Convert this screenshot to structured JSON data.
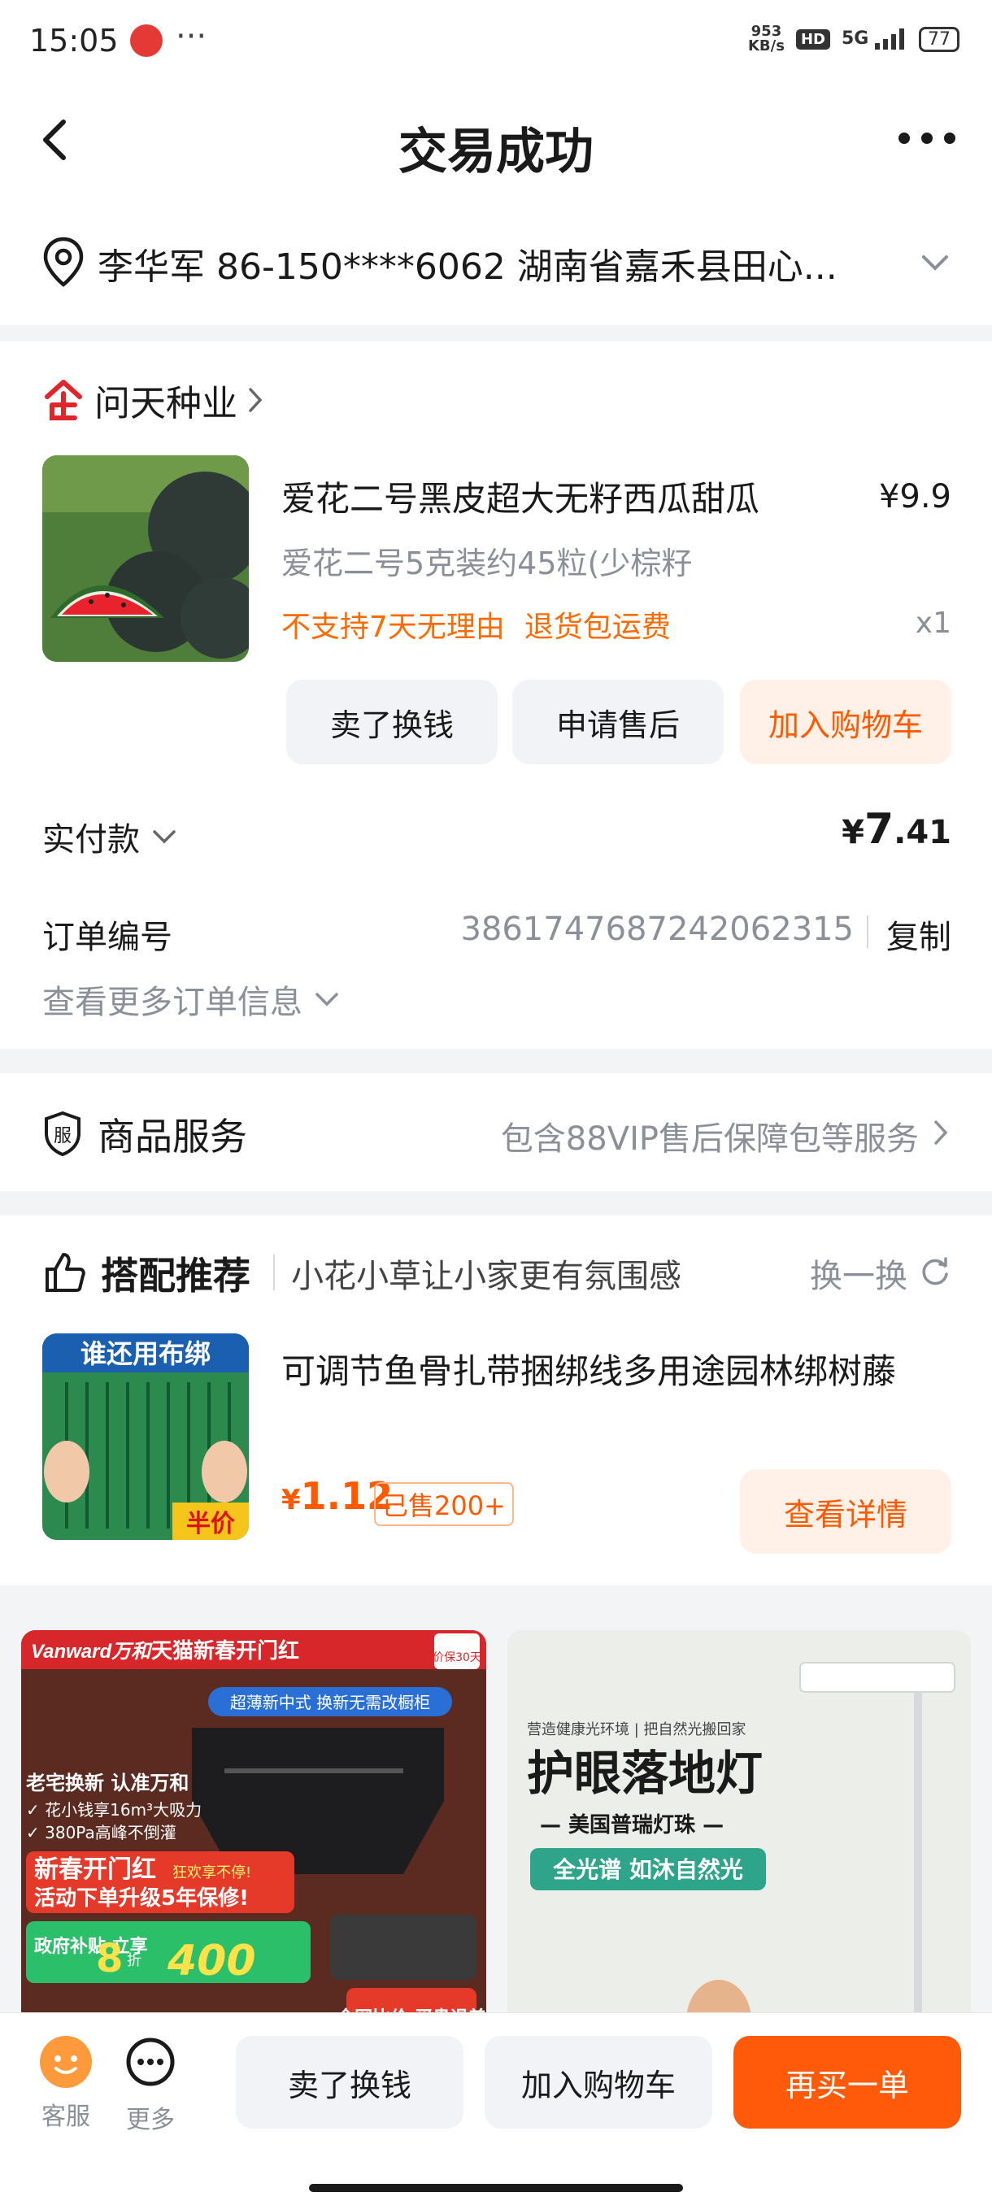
{
  "status_bar": {
    "time": "15:05",
    "dots": "···",
    "speed_top": "953",
    "speed_bottom": "KB/s",
    "hd": "HD",
    "signal": "5G",
    "battery": "77"
  },
  "header": {
    "title": "交易成功"
  },
  "address": {
    "text": "李华军  86-150****6062  湖南省嘉禾县田心..."
  },
  "shop": {
    "name": "问天种业"
  },
  "product": {
    "title": "爱花二号黑皮超大无籽西瓜甜瓜",
    "price": "¥9.9",
    "spec": "爱花二号5克装约45粒(少棕籽",
    "tags": [
      "不支持7天无理由",
      "退货包运费"
    ],
    "qty": "x1",
    "buttons": [
      "卖了换钱",
      "申请售后",
      "加入购物车"
    ]
  },
  "payment": {
    "label": "实付款",
    "currency": "¥",
    "amount_int": "7",
    "amount_dec": ".41"
  },
  "order": {
    "label": "订单编号",
    "number": "3861747687242062315",
    "copy": "复制",
    "more_info": "查看更多订单信息"
  },
  "service": {
    "title": "商品服务",
    "desc": "包含88VIP售后保障包等服务"
  },
  "recommend": {
    "title": "搭配推荐",
    "subtitle": "小花小草让小家更有氛围感",
    "swap": "换一换",
    "item_name": "可调节鱼骨扎带捆绑线多用途园林绑树藤",
    "currency": "¥",
    "price": "1.12",
    "sold": "已售200+",
    "detail_btn": "查看详情",
    "img_text_top": "谁还用布绑",
    "img_text_bottom": "半价"
  },
  "feed": {
    "card1": {
      "brand": "Vanward万和",
      "campaign": "天猫新春开门红",
      "badge": "价保30天",
      "pill": "超薄新中式 换新无需改橱柜",
      "headline": "老宅换新 认准万和",
      "bullets": [
        "✓ 花小钱享16m³大吸力",
        "✓ 380Pa高峰不倒灌"
      ],
      "promo1": "新春开门红",
      "promo1_sub": "狂欢享不停!",
      "promo2": "活动下单升级5年保修!",
      "subsidy": "政府补贴 立享",
      "subsidy_num": "8",
      "subsidy_unit": "折",
      "subsidy_value": "400",
      "compare": "全网比价 买贵退差"
    },
    "card2": {
      "tagline": "营造健康光环境 | 把自然光搬回家",
      "headline": "护眼落地灯",
      "sub": "— 美国普瑞灯珠 —",
      "pill": "全光谱 如沐自然光"
    }
  },
  "bottom_bar": {
    "service_label": "客服",
    "more_label": "更多",
    "btn_sell": "卖了换钱",
    "btn_cart": "加入购物车",
    "btn_rebuy": "再买一单"
  },
  "colors": {
    "accent": "#ff5a00",
    "brand_red": "#e0262a",
    "muted": "#8a8f99"
  }
}
